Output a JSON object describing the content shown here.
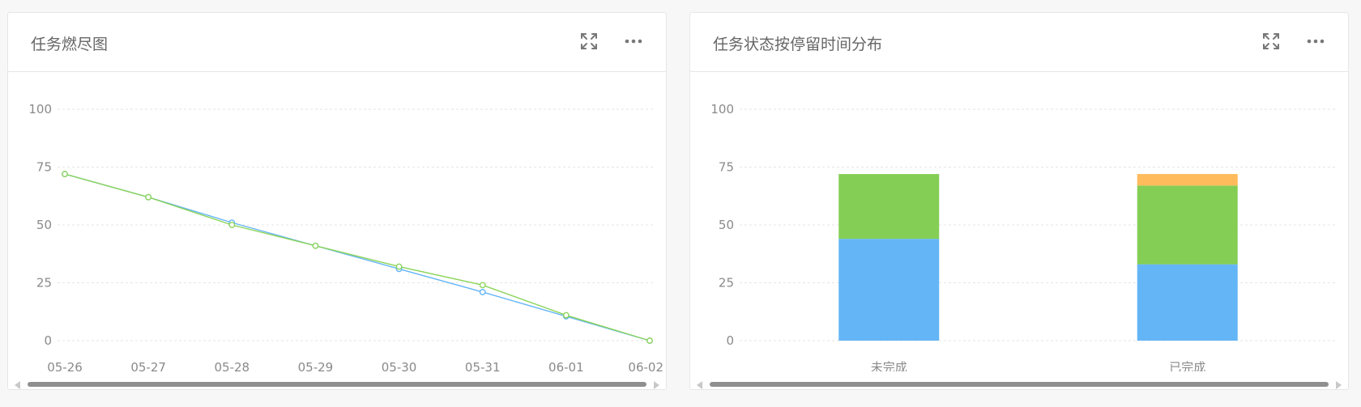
{
  "colors": {
    "series_blue": "#64b5f6",
    "series_green": "#8bd45a",
    "bar_orange": "#ffbb5c",
    "point_fill": "#ffffff"
  },
  "icons": {
    "expand": "expand-icon",
    "more": "more-icon"
  },
  "panels": [
    {
      "title": "任务燃尽图",
      "chart_data": {
        "type": "line",
        "title": "任务燃尽图",
        "categories": [
          "05-26",
          "05-27",
          "05-28",
          "05-29",
          "05-30",
          "05-31",
          "06-01",
          "06-02"
        ],
        "series": [
          {
            "values": [
              72,
              62,
              51,
              41,
              31,
              21,
              10.5,
              0
            ],
            "color": "#64b5f6"
          },
          {
            "values": [
              72,
              62,
              50,
              41,
              32,
              24,
              11,
              0
            ],
            "color": "#8bd45a"
          }
        ],
        "ylim": [
          0,
          100
        ],
        "yticks": [
          "0",
          "25",
          "50",
          "75",
          "100"
        ],
        "grid": true,
        "xlabel": "",
        "ylabel": ""
      }
    },
    {
      "title": "任务状态按停留时间分布",
      "chart_data": {
        "type": "bar",
        "stacked": true,
        "title": "任务状态按停留时间分布",
        "categories": [
          "未完成",
          "已完成"
        ],
        "series": [
          {
            "values": [
              44,
              33
            ],
            "color": "#64b5f6"
          },
          {
            "values": [
              28,
              34
            ],
            "color": "#85ce55"
          },
          {
            "values": [
              0,
              5
            ],
            "color": "#ffbb5c"
          }
        ],
        "ylim": [
          0,
          100
        ],
        "yticks": [
          "0",
          "25",
          "50",
          "75",
          "100"
        ],
        "grid": true,
        "xlabel": "",
        "ylabel": ""
      }
    }
  ]
}
